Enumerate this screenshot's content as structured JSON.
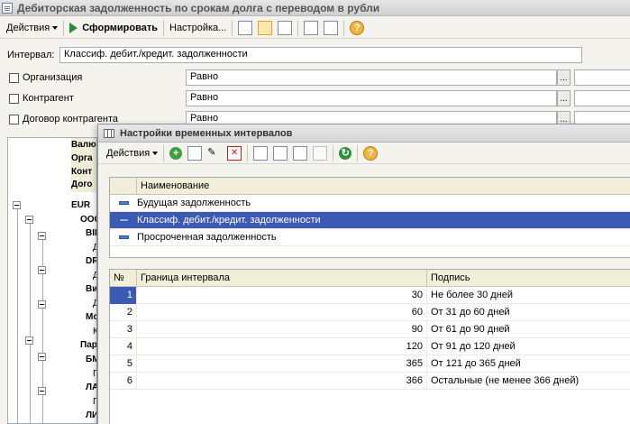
{
  "window": {
    "title": "Дебиторская задолженность по срокам долга с переводом в рубли"
  },
  "toolbar": {
    "actions_label": "Действия",
    "generate_label": "Сформировать",
    "settings_label": "Настройка..."
  },
  "interval": {
    "label": "Интервал:",
    "value": "Классиф. дебит./кредит. задолженности",
    "dots": "..."
  },
  "filters": [
    {
      "label": "Организация",
      "condition": "Равно"
    },
    {
      "label": "Контрагент",
      "condition": "Равно"
    },
    {
      "label": "Договор контрагента",
      "condition": "Равно"
    }
  ],
  "report": {
    "header_cells": [
      "Валю",
      "Орга",
      "Конт",
      "Дого"
    ],
    "cells": [
      "EUR",
      "ООС",
      "ВІІ",
      "Д",
      "DR",
      "Д",
      "Ви",
      "Д",
      "Мо",
      "К",
      "Пар",
      "БМ",
      "Г",
      "ЛА",
      "Г",
      "ЛИ"
    ]
  },
  "dialog": {
    "title": "Настройки временных интервалов",
    "actions_label": "Действия",
    "kinds_header": "Наименование",
    "kinds": [
      {
        "name": "Будущая задолженность",
        "selected": false
      },
      {
        "name": "Классиф. дебит./кредит. задолженности",
        "selected": true
      },
      {
        "name": "Просроченная задолженность",
        "selected": false
      }
    ],
    "intervals_header": {
      "num": "№",
      "boundary": "Граница интервала",
      "caption": "Подпись"
    },
    "intervals": [
      {
        "num": "1",
        "boundary": "30",
        "caption": "Не более 30 дней"
      },
      {
        "num": "2",
        "boundary": "60",
        "caption": "От 31 до 60 дней"
      },
      {
        "num": "3",
        "boundary": "90",
        "caption": "От 61 до 90 дней"
      },
      {
        "num": "4",
        "boundary": "120",
        "caption": "От 91 до 120 дней"
      },
      {
        "num": "5",
        "boundary": "365",
        "caption": "От 121 до 365 дней"
      },
      {
        "num": "6",
        "boundary": "366",
        "caption": "Остальные (не менее 366 дней)"
      }
    ]
  },
  "colors": {
    "selection": "#3c5ab4",
    "header_bg": "#f0eed8"
  }
}
